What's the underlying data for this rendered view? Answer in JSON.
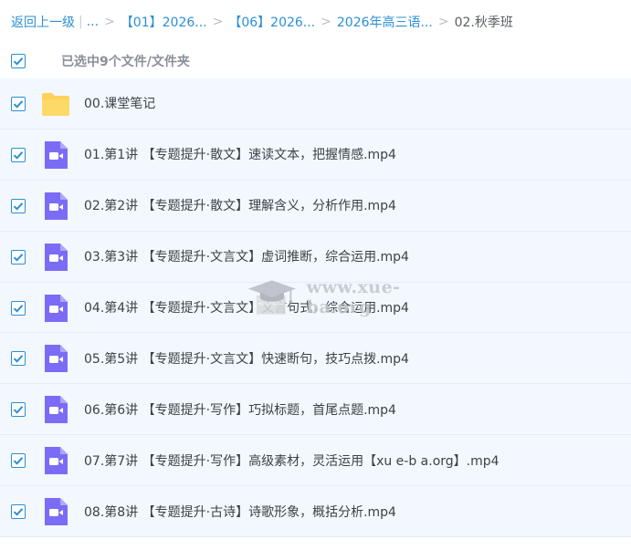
{
  "breadcrumb": {
    "back": "返回上一级",
    "pipe": "|",
    "ellipsis": "...",
    "sep": ">",
    "crumbs": [
      "【01】2026...",
      "【06】2026...",
      "2026年高三语..."
    ],
    "current": "02.秋季班"
  },
  "selection": {
    "text": "已选中9个文件/文件夹",
    "all_checked": true
  },
  "files": [
    {
      "name": "00.课堂笔记",
      "icon": "folder-icon"
    },
    {
      "name": "01.第1讲 【专题提升·散文】速读文本，把握情感.mp4",
      "icon": "video-file-icon"
    },
    {
      "name": "02.第2讲 【专题提升·散文】理解含义，分析作用.mp4",
      "icon": "video-file-icon"
    },
    {
      "name": "03.第3讲 【专题提升·文言文】虚词推断，综合运用.mp4",
      "icon": "video-file-icon"
    },
    {
      "name": "04.第4讲 【专题提升·文言文】文言句式，综合运用.mp4",
      "icon": "video-file-icon"
    },
    {
      "name": "05.第5讲 【专题提升·文言文】快速断句，技巧点拨.mp4",
      "icon": "video-file-icon"
    },
    {
      "name": "06.第6讲 【专题提升·写作】巧拟标题，首尾点题.mp4",
      "icon": "video-file-icon"
    },
    {
      "name": "07.第7讲 【专题提升·写作】高级素材，灵活运用【xu e-b a.org】.mp4",
      "icon": "video-file-icon"
    },
    {
      "name": "08.第8讲 【专题提升·古诗】诗歌形象，概括分析.mp4",
      "icon": "video-file-icon"
    }
  ],
  "watermark": {
    "text": "www.xue-ba.org",
    "icon": "graduation-cap-icon"
  },
  "colors": {
    "accent": "#2b8fd6",
    "row_bg": "#f2f8fe",
    "folder": "#fcd25a",
    "video": "#7b6cf6"
  }
}
